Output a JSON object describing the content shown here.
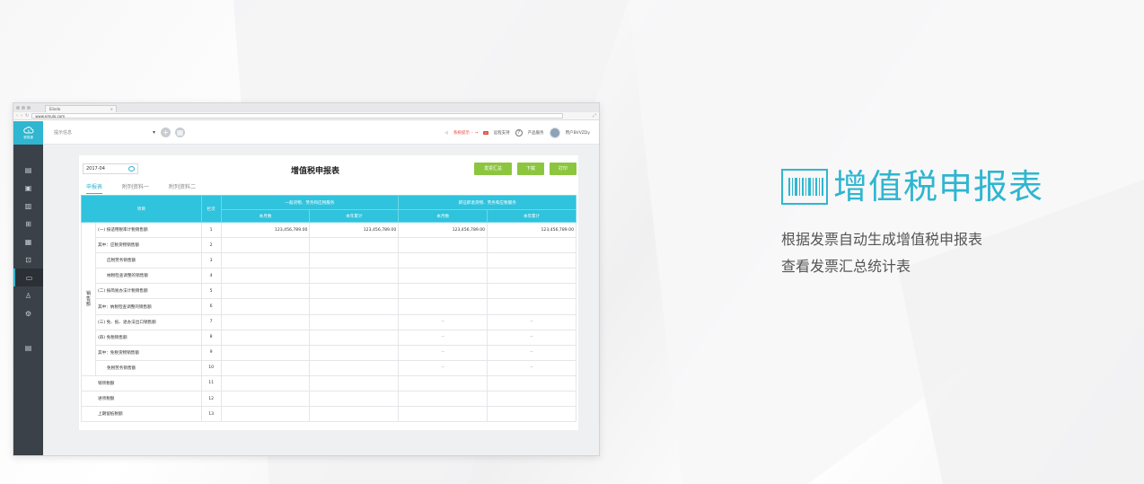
{
  "browser": {
    "tab_title": "Elindo",
    "url": "www.emulo.com"
  },
  "app": {
    "logo_text": "税易通",
    "company_placeholder": "提示信息",
    "top_right": {
      "notice": "系统提示 ·· →",
      "support": "远程支持",
      "service": "产品服务",
      "user": "用户BVVZDy"
    }
  },
  "sidebar": {
    "items": [
      {
        "icon": "file-icon"
      },
      {
        "icon": "invoice-icon"
      },
      {
        "icon": "chart-icon"
      },
      {
        "icon": "stamp-icon"
      },
      {
        "icon": "receipt-icon"
      },
      {
        "icon": "search-doc-icon"
      },
      {
        "icon": "tax-report-icon",
        "active": true
      },
      {
        "icon": "user-group-icon"
      },
      {
        "icon": "settings-icon"
      },
      {
        "icon": "archive-icon"
      }
    ]
  },
  "report": {
    "date": "2017-04",
    "title": "增值税申报表",
    "buttons": {
      "summary": "发票汇总",
      "download": "下载",
      "print": "打印"
    },
    "tabs": [
      "申报表",
      "附列资料一",
      "附列资料二"
    ],
    "headers": {
      "item": "项目",
      "col_no": "栏次",
      "group1": "一般货物、劳务和应税服务",
      "group2": "即征即退货物、劳务和应税服务",
      "month": "本月数",
      "year": "本年累计"
    },
    "section_label": "销售额",
    "rows": [
      {
        "label": "(一) 按适用税率计税销售额",
        "no": "1",
        "c1": "123,456,789.00",
        "c2": "123,456,789.00",
        "c3": "123,456,789.00",
        "c4": "123,456,789.00"
      },
      {
        "label": "其中：应税货物销售额",
        "no": "2",
        "c1": "",
        "c2": "",
        "c3": "",
        "c4": ""
      },
      {
        "label": "应税劳务销售额",
        "no": "3",
        "c1": "",
        "c2": "",
        "c3": "",
        "c4": "",
        "indent": true
      },
      {
        "label": "纳税检查调整的销售额",
        "no": "4",
        "c1": "",
        "c2": "",
        "c3": "",
        "c4": "",
        "indent": true
      },
      {
        "label": "(二) 按简易办法计税销售额",
        "no": "5",
        "c1": "",
        "c2": "",
        "c3": "",
        "c4": ""
      },
      {
        "label": "其中：纳税检查调整的销售额",
        "no": "6",
        "c1": "",
        "c2": "",
        "c3": "",
        "c4": ""
      },
      {
        "label": "(三) 免、抵、退办法出口销售额",
        "no": "7",
        "c1": "",
        "c2": "",
        "c3": "--",
        "c4": "--"
      },
      {
        "label": "(四) 免税销售额",
        "no": "8",
        "c1": "",
        "c2": "",
        "c3": "--",
        "c4": "--"
      },
      {
        "label": "其中：免税货物销售额",
        "no": "9",
        "c1": "",
        "c2": "",
        "c3": "--",
        "c4": "--"
      },
      {
        "label": "免税劳务销售额",
        "no": "10",
        "c1": "",
        "c2": "",
        "c3": "--",
        "c4": "--",
        "indent": true
      }
    ],
    "tail_rows": [
      {
        "label": "销项税额",
        "no": "11"
      },
      {
        "label": "进项税额",
        "no": "12"
      },
      {
        "label": "上期留抵税额",
        "no": "13"
      }
    ]
  },
  "feature": {
    "title": "增值税申报表",
    "lines": [
      "根据发票自动生成增值税申报表",
      "查看发票汇总统计表"
    ],
    "accent": "#2fb6d0"
  }
}
